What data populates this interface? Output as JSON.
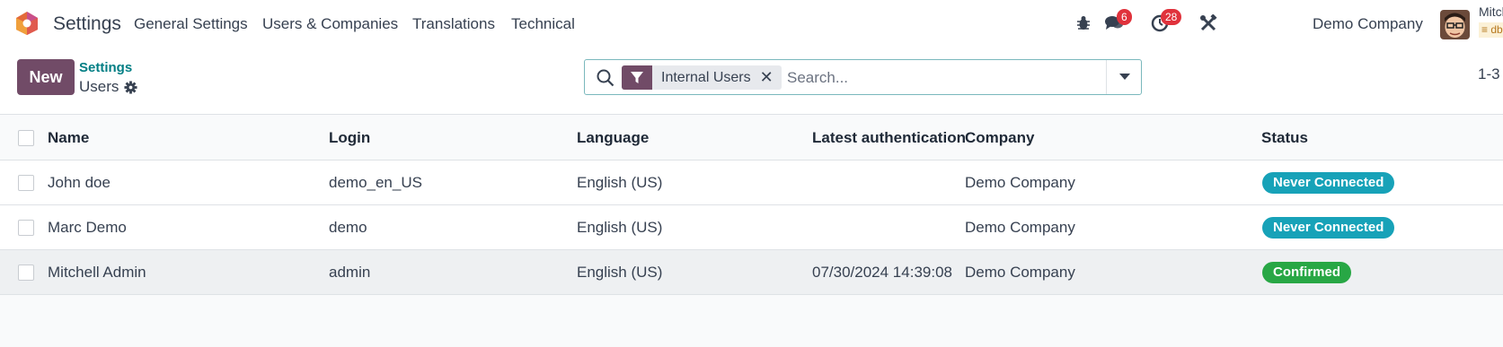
{
  "navbar": {
    "app_name": "Settings",
    "menu": [
      "General Settings",
      "Users & Companies",
      "Translations",
      "Technical"
    ],
    "messages_count": "6",
    "activities_count": "28",
    "company": "Demo Company",
    "user_name": "Mitchell Admin",
    "db_name": "db"
  },
  "control_panel": {
    "new_label": "New",
    "breadcrumb_parent": "Settings",
    "breadcrumb_current": "Users",
    "facet_label": "Internal Users",
    "facet_remove": "✕",
    "search_placeholder": "Search...",
    "pager": "1-3"
  },
  "table": {
    "columns": [
      "Name",
      "Login",
      "Language",
      "Latest authentication",
      "Company",
      "Status"
    ],
    "rows": [
      {
        "name": "John doe",
        "login": "demo_en_US",
        "language": "English (US)",
        "latest_auth": "",
        "company": "Demo Company",
        "status": "Never Connected"
      },
      {
        "name": "Marc Demo",
        "login": "demo",
        "language": "English (US)",
        "latest_auth": "",
        "company": "Demo Company",
        "status": "Never Connected"
      },
      {
        "name": "Mitchell Admin",
        "login": "admin",
        "language": "English (US)",
        "latest_auth": "07/30/2024 14:39:08",
        "company": "Demo Company",
        "status": "Confirmed"
      }
    ]
  },
  "colors": {
    "brand": "#714b67",
    "never_connected": "#17a2b8",
    "confirmed": "#28a745",
    "link": "#017e84"
  }
}
